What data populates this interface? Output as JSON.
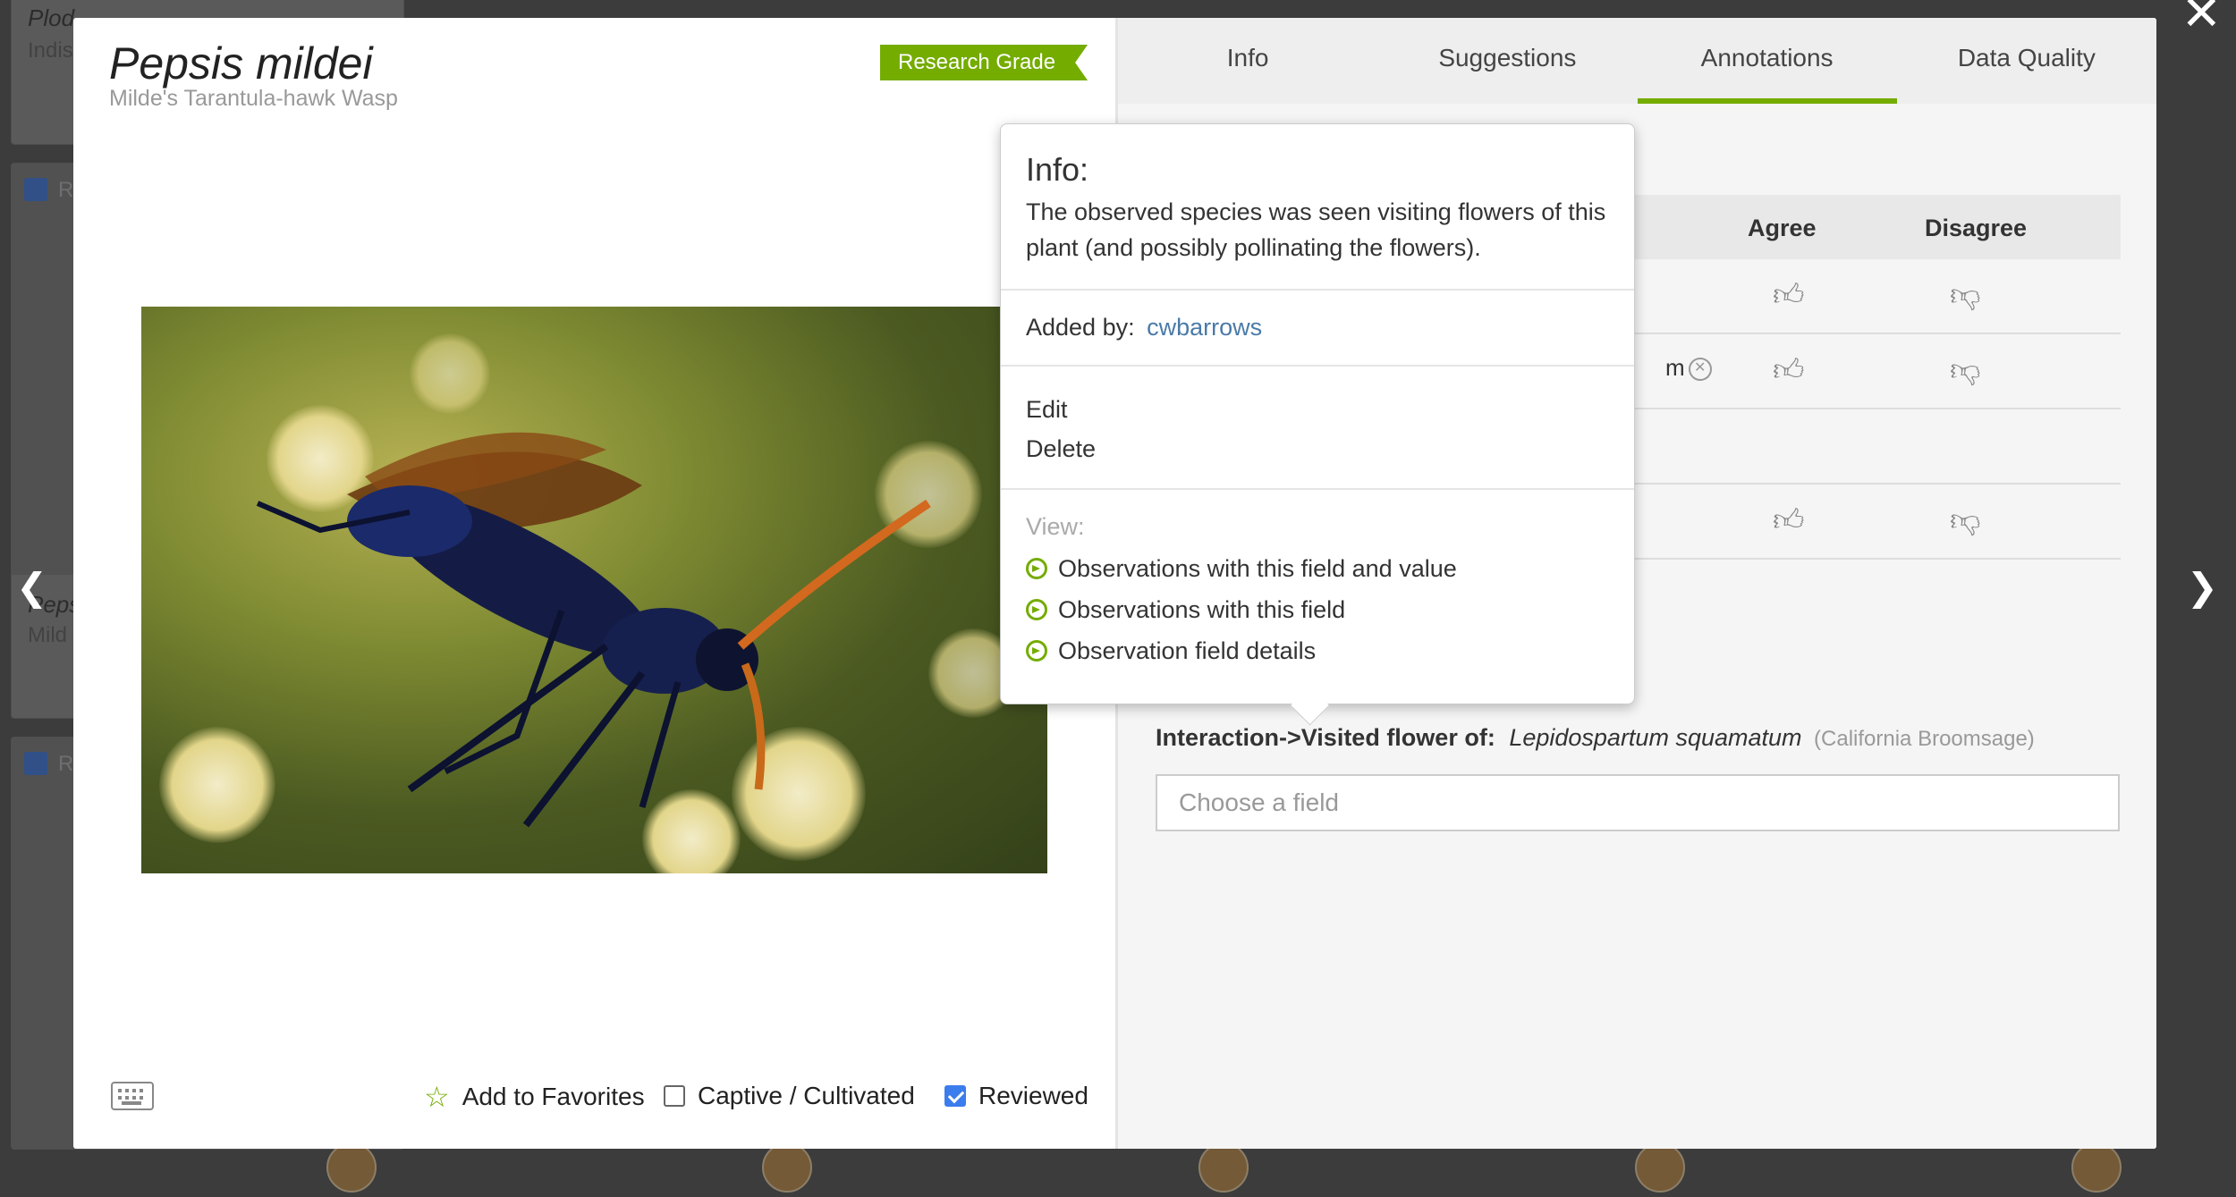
{
  "background_cards": [
    {
      "name": "Plod",
      "sub": "Indis"
    },
    {
      "name": "Peps",
      "sub": "Mild"
    },
    {
      "name": "",
      "sub": ""
    }
  ],
  "background_check_label": "Re",
  "nav": {
    "prev": "❮",
    "next": "❯",
    "close": "✕"
  },
  "observation": {
    "taxon": "Pepsis mildei",
    "common": "Milde's Tarantula-hawk Wasp",
    "grade": "Research Grade"
  },
  "bottom": {
    "favorites": "Add to Favorites",
    "captive": "Captive / Cultivated",
    "captive_checked": false,
    "reviewed": "Reviewed",
    "reviewed_checked": true
  },
  "tabs": [
    {
      "label": "Info",
      "active": false
    },
    {
      "label": "Suggestions",
      "active": false
    },
    {
      "label": "Annotations",
      "active": true
    },
    {
      "label": "Data Quality",
      "active": false
    }
  ],
  "annotations": {
    "col_agree": "Agree",
    "col_disagree": "Disagree",
    "row_fragment": "m"
  },
  "field": {
    "label": "Interaction->Visited flower of:",
    "value_sci": "Lepidospartum squamatum",
    "value_common": "(California Broomsage)",
    "input_placeholder": "Choose a field"
  },
  "popover": {
    "title": "Info:",
    "description": "The observed species was seen visiting flowers of this plant (and possibly pollinating the flowers).",
    "added_by_label": "Added by:",
    "added_by_user": "cwbarrows",
    "edit": "Edit",
    "delete": "Delete",
    "view_label": "View:",
    "links": [
      "Observations with this field and value",
      "Observations with this field",
      "Observation field details"
    ]
  },
  "colors": {
    "accent": "#74ac00",
    "link": "#4a7aa8",
    "checkbox": "#3b7ded"
  }
}
